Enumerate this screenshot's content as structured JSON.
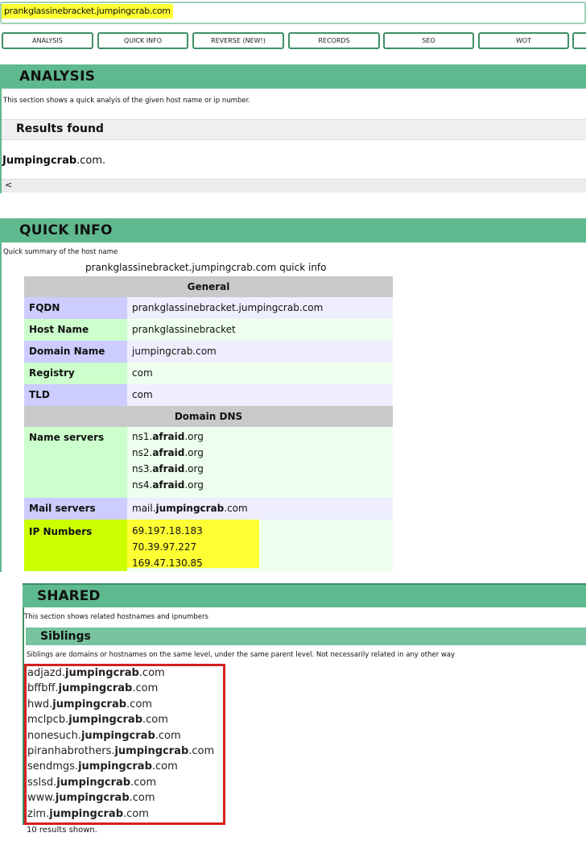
{
  "url": "prankglassinebracket.jumpingcrab.com",
  "nav": [
    "ANALYSIS",
    "QUICK INFO",
    "REVERSE (NEW!)",
    "RECORDS",
    "SEO",
    "WOT"
  ],
  "analysis": {
    "title": "ANALYSIS",
    "desc": "This section shows a quick analyis of the given host name or ip number.",
    "results_heading": "Results found",
    "result_bold": "Jumpingcrab",
    "result_rest": ".com.",
    "scroll_glyph": "<"
  },
  "quickinfo": {
    "title": "QUICK INFO",
    "desc": "Quick summary of the host name",
    "caption": "prankglassinebracket.jumpingcrab.com quick info",
    "general_header": "General",
    "fqdn_label": "FQDN",
    "fqdn": "prankglassinebracket.jumpingcrab.com",
    "host_label": "Host Name",
    "host": "prankglassinebracket",
    "domain_label": "Domain Name",
    "domain": "jumpingcrab.com",
    "registry_label": "Registry",
    "registry": "com",
    "tld_label": "TLD",
    "tld": "com",
    "dns_header": "Domain DNS",
    "ns_label": "Name servers",
    "ns": [
      {
        "pre": "ns1.",
        "bold": "afraid",
        "post": ".org"
      },
      {
        "pre": "ns2.",
        "bold": "afraid",
        "post": ".org"
      },
      {
        "pre": "ns3.",
        "bold": "afraid",
        "post": ".org"
      },
      {
        "pre": "ns4.",
        "bold": "afraid",
        "post": ".org"
      }
    ],
    "mx_label": "Mail servers",
    "mx": {
      "pre": "mail.",
      "bold": "jumpingcrab",
      "post": ".com"
    },
    "ip_label": "IP Numbers",
    "ips": [
      "69.197.18.183",
      "70.39.97.227",
      "169.47.130.85"
    ]
  },
  "shared": {
    "title": "SHARED",
    "desc": "This section shows related hostnames and ipnumbers",
    "siblings_heading": "Siblings",
    "siblings_desc": "Siblings are domains or hostnames on the same level, under the same parent level. Not necessarily related in any other way",
    "siblings": [
      {
        "pre": "adjazd.",
        "bold": "jumpingcrab",
        "post": ".com"
      },
      {
        "pre": "bffbff.",
        "bold": "jumpingcrab",
        "post": ".com"
      },
      {
        "pre": "hwd.",
        "bold": "jumpingcrab",
        "post": ".com"
      },
      {
        "pre": "mclpcb.",
        "bold": "jumpingcrab",
        "post": ".com"
      },
      {
        "pre": "nonesuch.",
        "bold": "jumpingcrab",
        "post": ".com"
      },
      {
        "pre": "piranhabrothers.",
        "bold": "jumpingcrab",
        "post": ".com"
      },
      {
        "pre": "sendmgs.",
        "bold": "jumpingcrab",
        "post": ".com"
      },
      {
        "pre": "sslsd.",
        "bold": "jumpingcrab",
        "post": ".com"
      },
      {
        "pre": "www.",
        "bold": "jumpingcrab",
        "post": ".com"
      },
      {
        "pre": "zim.",
        "bold": "jumpingcrab",
        "post": ".com"
      }
    ],
    "count_text": "10 results shown."
  },
  "colors": {
    "accent_green": "#5fb98f",
    "button_border": "#3f8f66",
    "highlight_yellow": "#ffff33",
    "ip_highlight": "#ccff00",
    "red_box": "#d42020"
  }
}
